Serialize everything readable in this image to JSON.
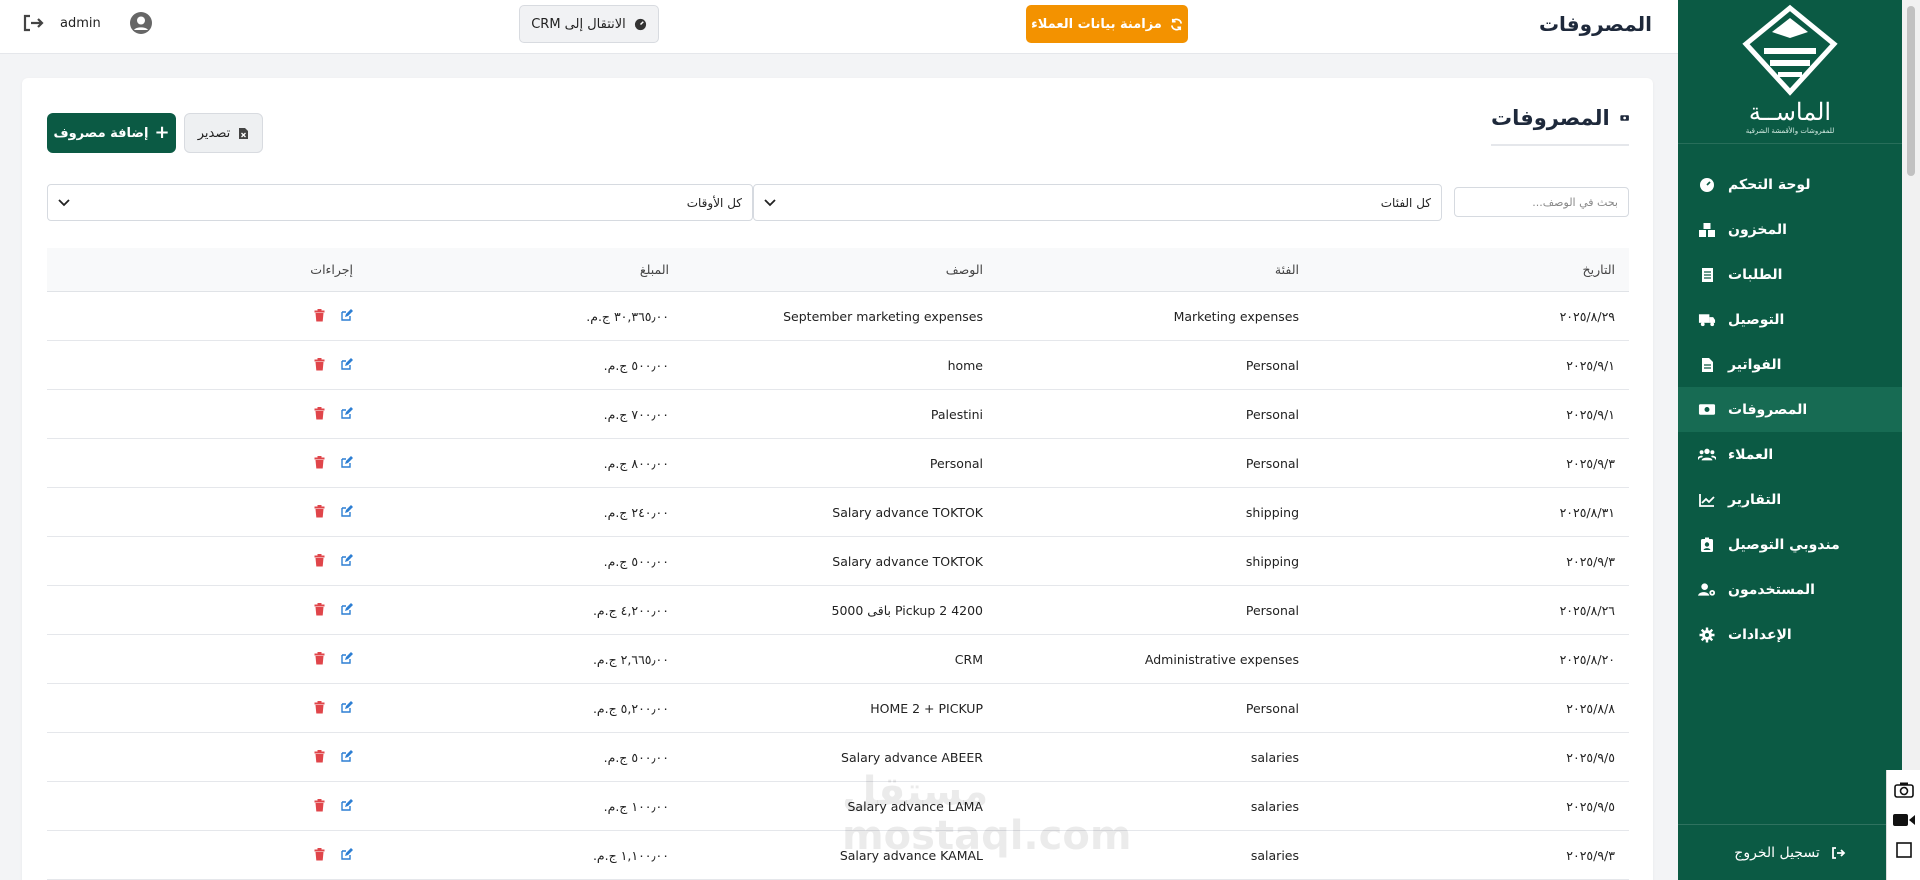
{
  "brand": {
    "name": "الماســة",
    "tagline": "للمفروشات والأقمشة الشرقية"
  },
  "colors": {
    "sidebar": "#0b5a44",
    "accent_orange": "#f39200",
    "danger": "#e0454a",
    "edit": "#2d7fd3"
  },
  "sidebar": {
    "items": [
      {
        "label": "لوحة التحكم",
        "icon": "gauge-icon",
        "active": false
      },
      {
        "label": "المخزون",
        "icon": "boxes-icon",
        "active": false
      },
      {
        "label": "الطلبات",
        "icon": "receipt-icon",
        "active": false
      },
      {
        "label": "التوصيل",
        "icon": "truck-icon",
        "active": false
      },
      {
        "label": "الفواتير",
        "icon": "file-invoice-icon",
        "active": false
      },
      {
        "label": "المصروفات",
        "icon": "money-bill-icon",
        "active": true
      },
      {
        "label": "العملاء",
        "icon": "users-icon",
        "active": false
      },
      {
        "label": "التقارير",
        "icon": "chart-line-icon",
        "active": false
      },
      {
        "label": "مندوبي التوصيل",
        "icon": "id-badge-icon",
        "active": false
      },
      {
        "label": "المستخدمون",
        "icon": "user-gear-icon",
        "active": false
      },
      {
        "label": "الإعدادات",
        "icon": "gear-icon",
        "active": false
      }
    ],
    "logout_label": "تسجيل الخروج"
  },
  "topbar": {
    "title": "المصروفات",
    "sync_label": "مزامنة بيانات العملاء",
    "crm_label": "الانتقال إلى CRM",
    "username": "admin"
  },
  "page": {
    "title": "المصروفات",
    "add_label": "إضافة مصروف",
    "export_label": "تصدير",
    "search_placeholder": "بحث في الوصف...",
    "category_filter": "كل الفئات",
    "time_filter": "كل الأوقات"
  },
  "table": {
    "headers": {
      "date": "التاريخ",
      "category": "الفئة",
      "description": "الوصف",
      "amount": "المبلغ",
      "actions": "إجراءات"
    },
    "rows": [
      {
        "date": "٢٠٢٥/٨/٢٩",
        "category": "Marketing expenses",
        "description": "September marketing expenses",
        "amount": "٣٠,٣٦٥٫٠٠ ج.م."
      },
      {
        "date": "٢٠٢٥/٩/١",
        "category": "Personal",
        "description": "home",
        "amount": "٥٠٠٫٠٠ ج.م."
      },
      {
        "date": "٢٠٢٥/٩/١",
        "category": "Personal",
        "description": "Palestini",
        "amount": "٧٠٠٫٠٠ ج.م."
      },
      {
        "date": "٢٠٢٥/٩/٣",
        "category": "Personal",
        "description": "Personal",
        "amount": "٨٠٠٫٠٠ ج.م."
      },
      {
        "date": "٢٠٢٥/٨/٣١",
        "category": "shipping",
        "description": "Salary advance TOKTOK",
        "amount": "٢٤٠٫٠٠ ج.م."
      },
      {
        "date": "٢٠٢٥/٩/٣",
        "category": "shipping",
        "description": "Salary advance TOKTOK",
        "amount": "٥٠٠٫٠٠ ج.م."
      },
      {
        "date": "٢٠٢٥/٨/٢٦",
        "category": "Personal",
        "description": "Pickup 2 4200 باقى 5000",
        "amount": "٤,٢٠٠٫٠٠ ج.م."
      },
      {
        "date": "٢٠٢٥/٨/٢٠",
        "category": "Administrative expenses",
        "description": "CRM",
        "amount": "٢,٦٦٥٫٠٠ ج.م."
      },
      {
        "date": "٢٠٢٥/٨/٨",
        "category": "Personal",
        "description": "HOME 2 + PICKUP",
        "amount": "٥,٢٠٠٫٠٠ ج.م."
      },
      {
        "date": "٢٠٢٥/٩/٥",
        "category": "salaries",
        "description": "Salary advance ABEER",
        "amount": "٥٠٠٫٠٠ ج.م."
      },
      {
        "date": "٢٠٢٥/٩/٥",
        "category": "salaries",
        "description": "Salary advance LAMA",
        "amount": "١٠٠٫٠٠ ج.م."
      },
      {
        "date": "٢٠٢٥/٩/٣",
        "category": "salaries",
        "description": "Salary advance KAMAL",
        "amount": "١,١٠٠٫٠٠ ج.م."
      }
    ]
  },
  "watermark": {
    "line1": "مستقل",
    "line2": "mostaql.com"
  }
}
